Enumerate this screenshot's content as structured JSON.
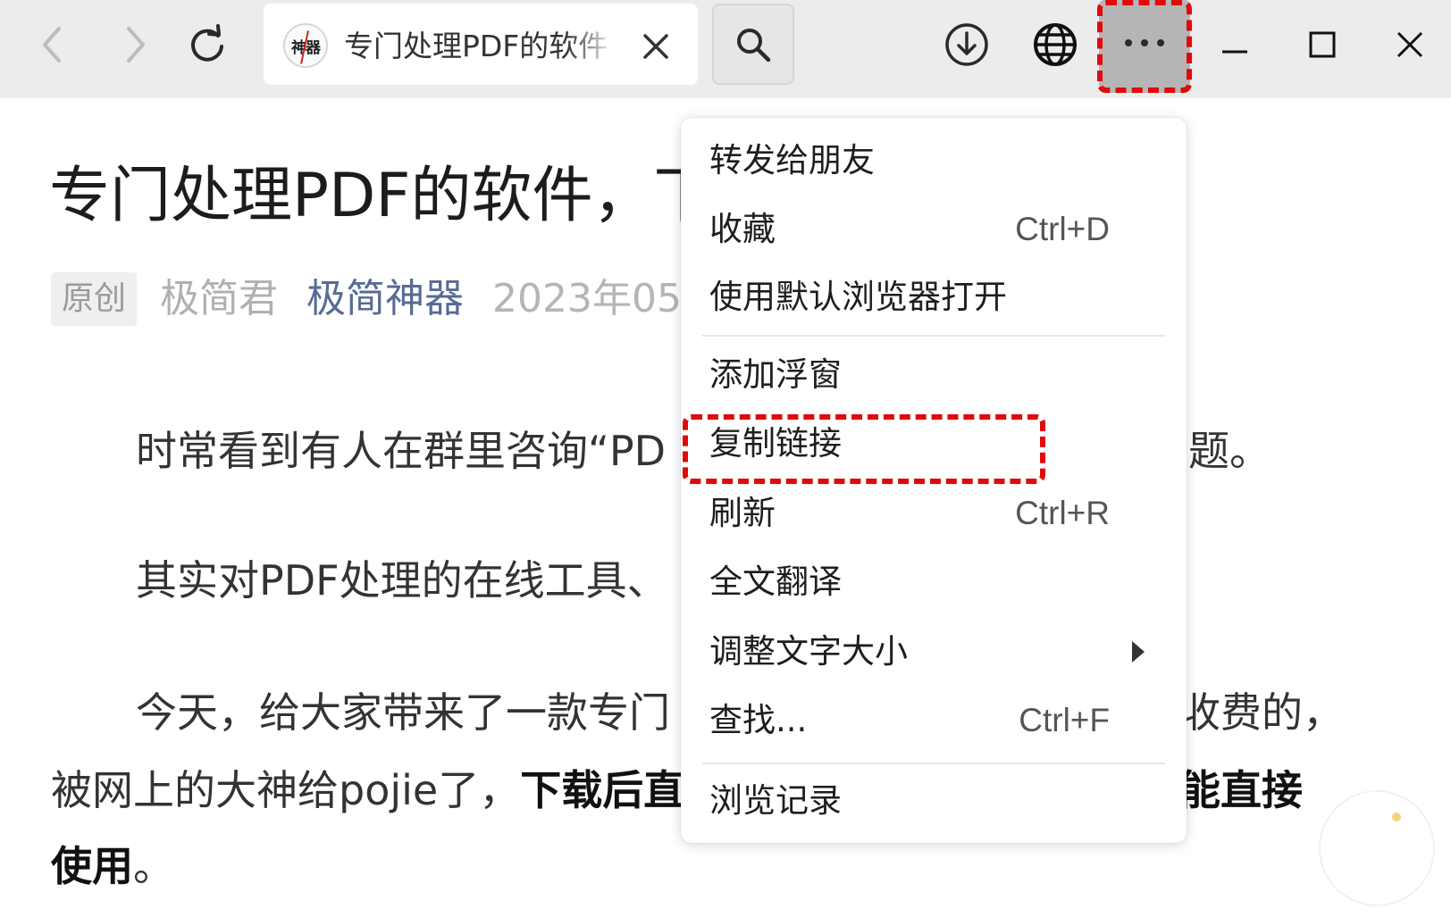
{
  "toolbar": {
    "back_icon": "chevron-left-icon",
    "forward_icon": "chevron-right-icon",
    "reload_icon": "reload-icon",
    "tab": {
      "favicon_text": "神器",
      "title": "专门处理PDF的软件",
      "close_icon": "close-icon"
    },
    "search_icon": "search-icon",
    "download_icon": "download-icon",
    "globe_icon": "globe-icon",
    "more_icon": "more-horizontal-icon",
    "minimize_icon": "minimize-icon",
    "maximize_icon": "maximize-icon",
    "close_window_icon": "close-icon"
  },
  "article": {
    "title": "专门处理PDF的软件，下",
    "badge": "原创",
    "author": "极简君",
    "account": "极简神器",
    "date": "2023年05",
    "p1_start": "时常看到有人在群里咨询“PD",
    "p1_end": "题。",
    "p2_start": "其实对PDF处理的在线工具、",
    "p3_start": "今天，给大家带来了一款专门",
    "p3_end": "收费的，",
    "p4_normal": "被网上的大神给pojie了，",
    "p4_bold": "下载后直",
    "p4_end_bold": "能直接",
    "p5_bold": "使用",
    "p5_tail": "。"
  },
  "context_menu": {
    "items": [
      {
        "label": "转发给朋友",
        "shortcut": ""
      },
      {
        "label": "收藏",
        "shortcut": "Ctrl+D"
      },
      {
        "label": "使用默认浏览器打开",
        "shortcut": ""
      },
      {
        "label": "添加浮窗",
        "shortcut": ""
      },
      {
        "label": "复制链接",
        "shortcut": ""
      },
      {
        "label": "刷新",
        "shortcut": "Ctrl+R"
      },
      {
        "label": "全文翻译",
        "shortcut": ""
      },
      {
        "label": "调整文字大小",
        "shortcut": ""
      },
      {
        "label": "查找...",
        "shortcut": "Ctrl+F"
      },
      {
        "label": "浏览记录",
        "shortcut": ""
      }
    ],
    "submenu_icon": "chevron-right-solid-icon"
  },
  "colors": {
    "highlight": "#e00a0a",
    "account_link": "#576b95",
    "toolbar_bg": "#ececec",
    "more_button_bg": "#b5b5b5"
  }
}
